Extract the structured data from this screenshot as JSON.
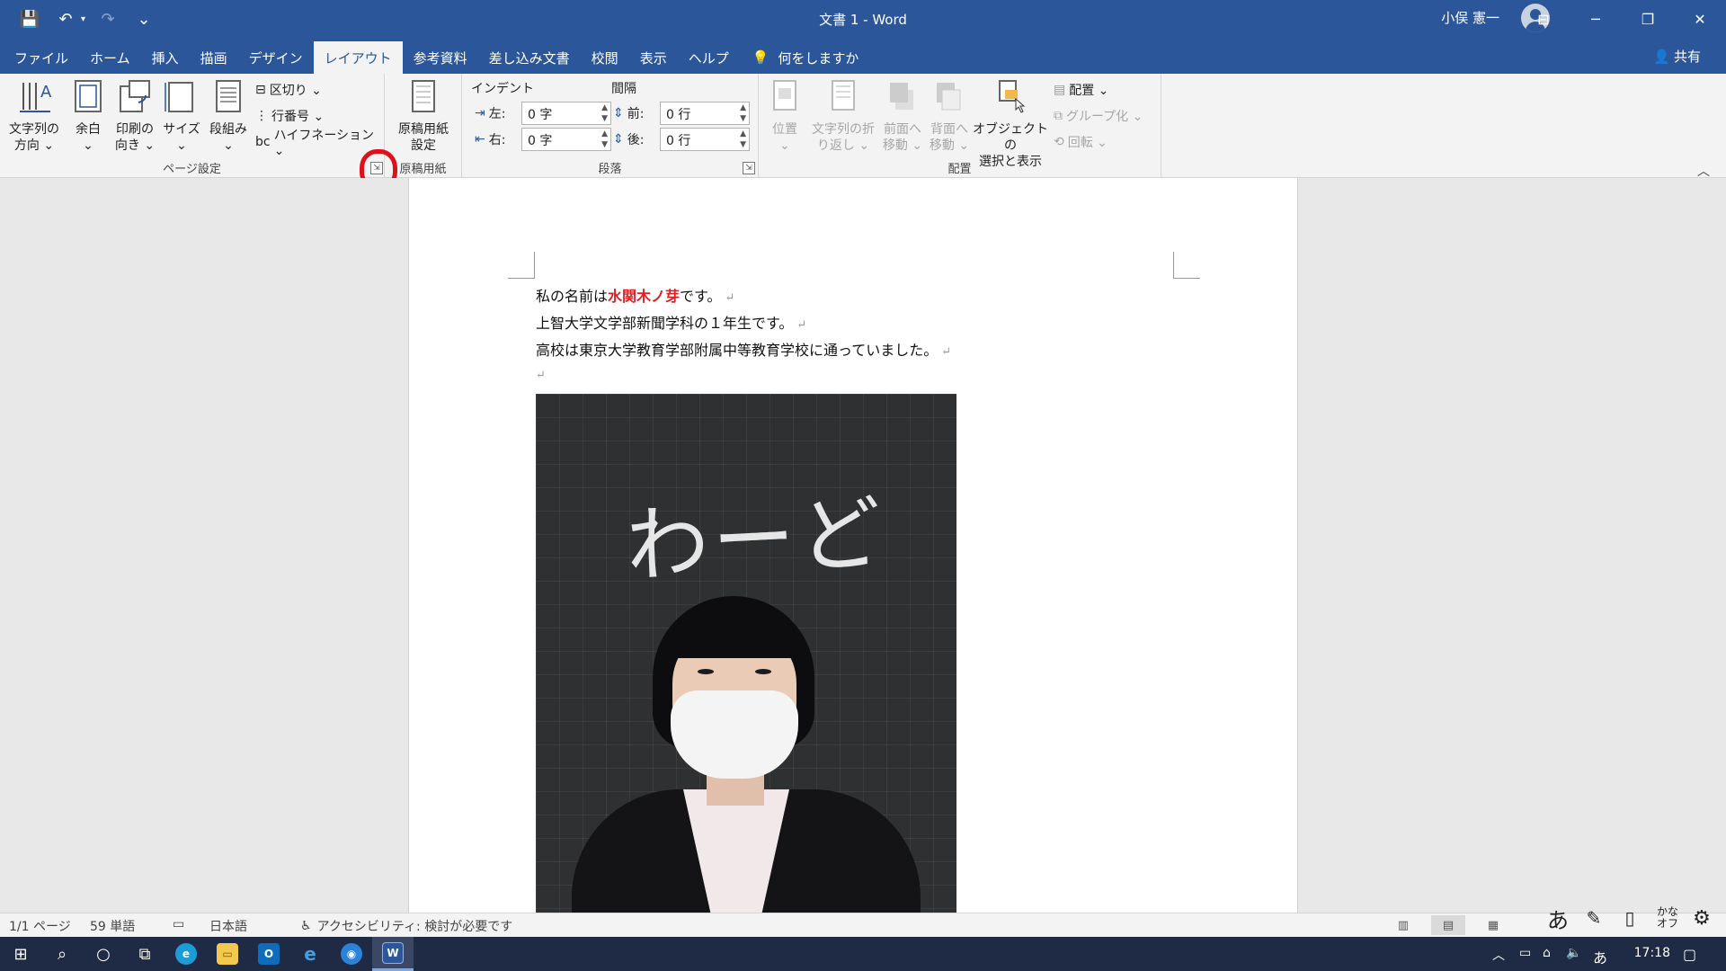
{
  "window": {
    "title": "文書 1  -  Word",
    "user_name": "小俣 憲一",
    "minimize": "─",
    "restore": "❐",
    "close": "✕",
    "display_options": "⊟"
  },
  "qat": {
    "save": "💾",
    "undo": "↶",
    "redo": "↷",
    "customize": "⌄"
  },
  "tabs": [
    "ファイル",
    "ホーム",
    "挿入",
    "描画",
    "デザイン",
    "レイアウト",
    "参考資料",
    "差し込み文書",
    "校閲",
    "表示",
    "ヘルプ"
  ],
  "active_tab": "レイアウト",
  "tell_me": "何をしますか",
  "share": "共有",
  "ribbon": {
    "page_setup": {
      "label": "ページ設定",
      "text_direction": [
        "文字列の",
        "方向 ⌄"
      ],
      "margins": [
        "余白",
        "⌄"
      ],
      "orientation": [
        "印刷の",
        "向き ⌄"
      ],
      "size": [
        "サイズ",
        "⌄"
      ],
      "columns": [
        "段組み",
        "⌄"
      ],
      "breaks": "区切り ⌄",
      "line_numbers": "行番号 ⌄",
      "hyphenation": "ハイフネーション ⌄",
      "launcher": "⇲"
    },
    "manuscript": {
      "label": "原稿用紙",
      "button": [
        "原稿用紙",
        "設定"
      ]
    },
    "paragraph": {
      "label": "段落",
      "indent_header": "インデント",
      "spacing_header": "間隔",
      "indent_left_label": "左:",
      "indent_left_value": "0 字",
      "indent_right_label": "右:",
      "indent_right_value": "0 字",
      "spacing_before_label": "前:",
      "spacing_before_value": "0 行",
      "spacing_after_label": "後:",
      "spacing_after_value": "0 行",
      "launcher": "⇲"
    },
    "arrange": {
      "label": "配置",
      "position": [
        "位置",
        "⌄"
      ],
      "wrap_text": [
        "文字列の折",
        "り返し ⌄"
      ],
      "bring_forward": [
        "前面へ",
        "移動 ⌄"
      ],
      "send_backward": [
        "背面へ",
        "移動 ⌄"
      ],
      "selection_pane": [
        "オブジェクトの",
        "選択と表示"
      ],
      "align": "配置 ⌄",
      "group": "グループ化 ⌄",
      "rotate": "回転 ⌄"
    },
    "collapse": "︿"
  },
  "document": {
    "line1_before": "私の名前は",
    "line1_highlight": "水関木ノ芽",
    "line1_after": "です。",
    "line2": "上智大学文学部新聞学科の１年生です。",
    "line3": "高校は東京大学教育学部附属中等教育学校に通っていました。",
    "para_mark": "↵",
    "photo_text": "わーど"
  },
  "status": {
    "page": "1/1 ページ",
    "words": "59 単語",
    "language": "日本語",
    "accessibility": "アクセシビリティ: 検討が必要です"
  },
  "ime": {
    "hiragana": "あ",
    "kana_off": [
      "かな",
      "オフ"
    ]
  },
  "taskbar": {
    "ime": "あ",
    "time": "17:18"
  },
  "colors": {
    "word_blue": "#2b579a",
    "annotation_red": "#e0101a",
    "highlight_red": "#e02020"
  }
}
